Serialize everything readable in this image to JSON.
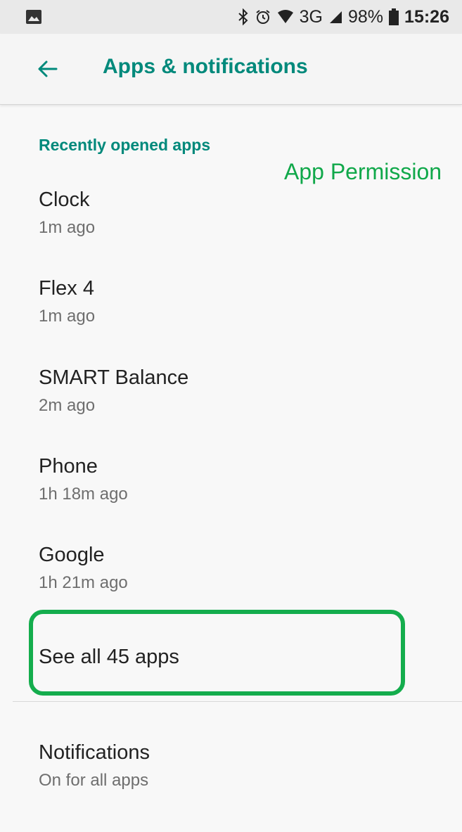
{
  "status_bar": {
    "icons": [
      "image-icon",
      "bluetooth-icon",
      "alarm-icon",
      "wifi-icon",
      "signal-icon",
      "battery-icon"
    ],
    "network": "3G",
    "battery": "98%",
    "time": "15:26"
  },
  "header": {
    "title": "Apps & notifications"
  },
  "recent": {
    "section_label": "Recently opened apps",
    "items": [
      {
        "name": "Clock",
        "time": "1m ago"
      },
      {
        "name": "Flex 4",
        "time": "1m ago"
      },
      {
        "name": "SMART Balance",
        "time": "2m ago"
      },
      {
        "name": "Phone",
        "time": "1h 18m ago"
      },
      {
        "name": "Google",
        "time": "1h 21m ago"
      }
    ],
    "see_all": "See all 45 apps"
  },
  "annotation": {
    "text": "App Permission",
    "color": "#10a84a"
  },
  "notifications": {
    "title": "Notifications",
    "subtitle": "On for all apps"
  },
  "colors": {
    "accent": "#00897b",
    "highlight": "#14ad4d"
  }
}
